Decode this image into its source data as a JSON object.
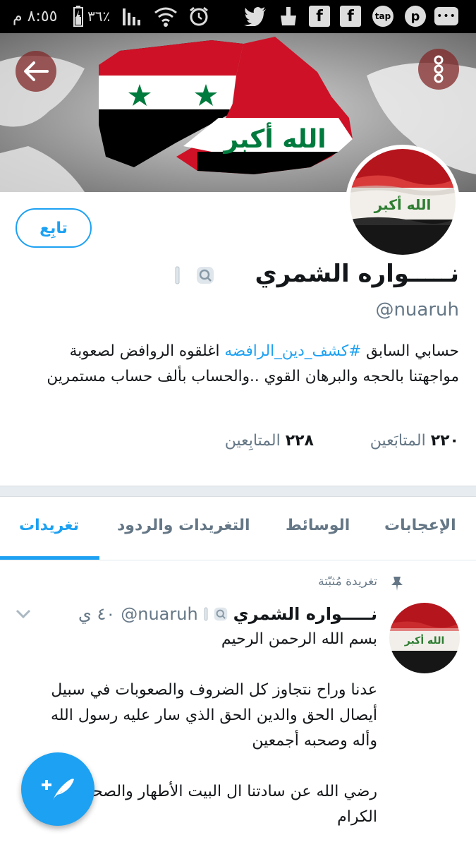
{
  "status_bar": {
    "time": "٨:٥٥ م",
    "battery": "٣٦٪",
    "icons": [
      "signal-icon",
      "wifi-icon",
      "alarm-icon",
      "twitter-icon",
      "cleaner-icon",
      "facebook-icon",
      "facebook-icon",
      "tap-icon",
      "messenger-icon",
      "more-icon"
    ],
    "tap_label": "tap"
  },
  "profile": {
    "name": "نـــــواره الشمري",
    "handle": "@nuaruh",
    "follow_label": "تابِع",
    "bio_prefix": "حسابي السابق ",
    "bio_hashtag": "#كشف_دين_الرافضه",
    "bio_suffix": " اغلقوه الروافض لصعوبة مواجهتنا بالحجه والبرهان القوي ..والحساب بألف حساب مستمرين",
    "following_count": "٢٢٠",
    "following_label": "المتابَعين",
    "followers_count": "٢٢٨",
    "followers_label": "المتابِعين",
    "flag_text": "الله أكبر"
  },
  "tabs": [
    {
      "label": "تغريدات",
      "active": true
    },
    {
      "label": "التغريدات والردود",
      "active": false
    },
    {
      "label": "الوسائط",
      "active": false
    },
    {
      "label": "الإعجابات",
      "active": false
    }
  ],
  "tweet": {
    "pinned_label": "تغريدة مُثبّتة",
    "author_name": "نـــــواره الشمري",
    "author_handle": "@nuaruh",
    "time": "٤٠ ي",
    "text": "بسم الله الرحمن الرحيم\n\nعدنا وراح نتجاوز كل الضروف والصعوبات في سبيل أيصال الحق والدين الحق الذي سار عليه رسول الله  وأله وصحبه أجمعين\n\nرضي الله عن سادتنا ال البيت الأطهار والصحابة الكرام"
  },
  "colors": {
    "accent": "#1da1f2",
    "text": "#14171a",
    "secondary": "#657786"
  }
}
